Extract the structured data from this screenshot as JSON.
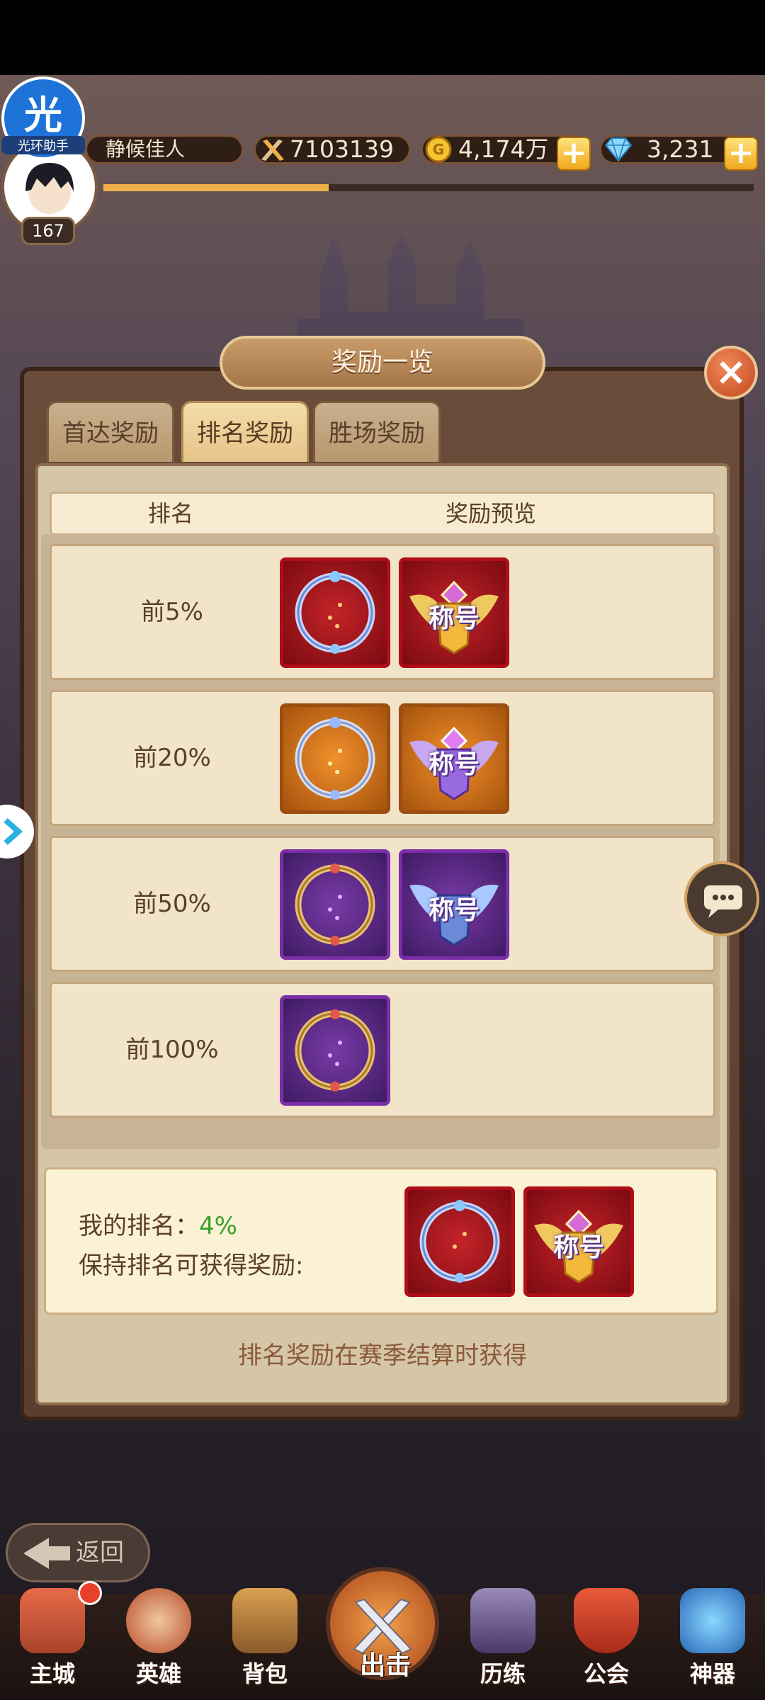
{
  "player": {
    "name": "静候佳人",
    "level": "167",
    "power": "7103139",
    "gold": "4,174万",
    "gems": "3,231",
    "assistant_label": "光环助手",
    "assistant_char": "光"
  },
  "dialog": {
    "title": "奖励一览",
    "tabs": [
      {
        "label": "首达奖励",
        "active": false
      },
      {
        "label": "排名奖励",
        "active": true
      },
      {
        "label": "胜场奖励",
        "active": false
      }
    ],
    "columns": {
      "rank": "排名",
      "preview": "奖励预览"
    },
    "rows": [
      {
        "rank": "前5%",
        "rewards": [
          {
            "tier": "red",
            "type": "frame"
          },
          {
            "tier": "red",
            "type": "title",
            "text": "称号"
          }
        ]
      },
      {
        "rank": "前20%",
        "rewards": [
          {
            "tier": "orange",
            "type": "frame"
          },
          {
            "tier": "orange",
            "type": "title",
            "text": "称号"
          }
        ]
      },
      {
        "rank": "前50%",
        "rewards": [
          {
            "tier": "purple",
            "type": "frame"
          },
          {
            "tier": "purple",
            "type": "title",
            "text": "称号"
          }
        ]
      },
      {
        "rank": "前100%",
        "rewards": [
          {
            "tier": "purple",
            "type": "frame"
          }
        ]
      }
    ],
    "my_rank_label": "我的排名：",
    "my_rank_value": "4%",
    "keep_rank_text": "保持排名可获得奖励:",
    "my_rewards": [
      {
        "tier": "red",
        "type": "frame"
      },
      {
        "tier": "red",
        "type": "title",
        "text": "称号"
      }
    ],
    "footnote": "排名奖励在赛季结算时获得"
  },
  "back_button": "返回",
  "nav": [
    {
      "label": "主城",
      "icon": "castle-icon"
    },
    {
      "label": "英雄",
      "icon": "hero-icon"
    },
    {
      "label": "背包",
      "icon": "backpack-icon"
    },
    {
      "label": "出击",
      "icon": "crossed-swords-icon"
    },
    {
      "label": "历练",
      "icon": "training-icon"
    },
    {
      "label": "公会",
      "icon": "guild-shield-icon"
    },
    {
      "label": "神器",
      "icon": "artifact-icon"
    }
  ],
  "colors": {
    "accent_green": "#3aa12a",
    "red_tier": "#b00e16",
    "orange_tier": "#9c4e10",
    "purple_tier": "#7a2ea8"
  }
}
